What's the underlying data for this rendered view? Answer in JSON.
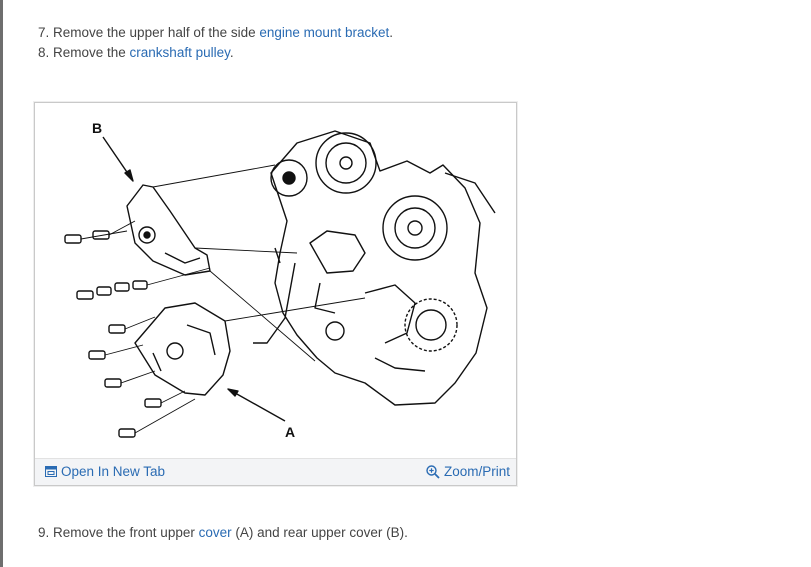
{
  "steps": {
    "step7": {
      "prefix": "7. Remove the upper half of the side ",
      "link": "engine mount bracket",
      "suffix": "."
    },
    "step8": {
      "prefix": "8. Remove the ",
      "link": "crankshaft pulley",
      "suffix": "."
    },
    "step9": {
      "prefix": "9. Remove the front upper ",
      "link": "cover",
      "suffix": " (A) and rear upper cover (B)."
    }
  },
  "figure": {
    "callout_a": "A",
    "callout_b": "B",
    "open_tab_label": "Open In New Tab",
    "zoom_label": "Zoom/Print",
    "open_tab_icon": "open-tab-icon",
    "zoom_icon": "magnifier-plus-icon"
  },
  "colors": {
    "link": "#2a6bb3",
    "text": "#444444",
    "bar": "#f3f4f6"
  }
}
